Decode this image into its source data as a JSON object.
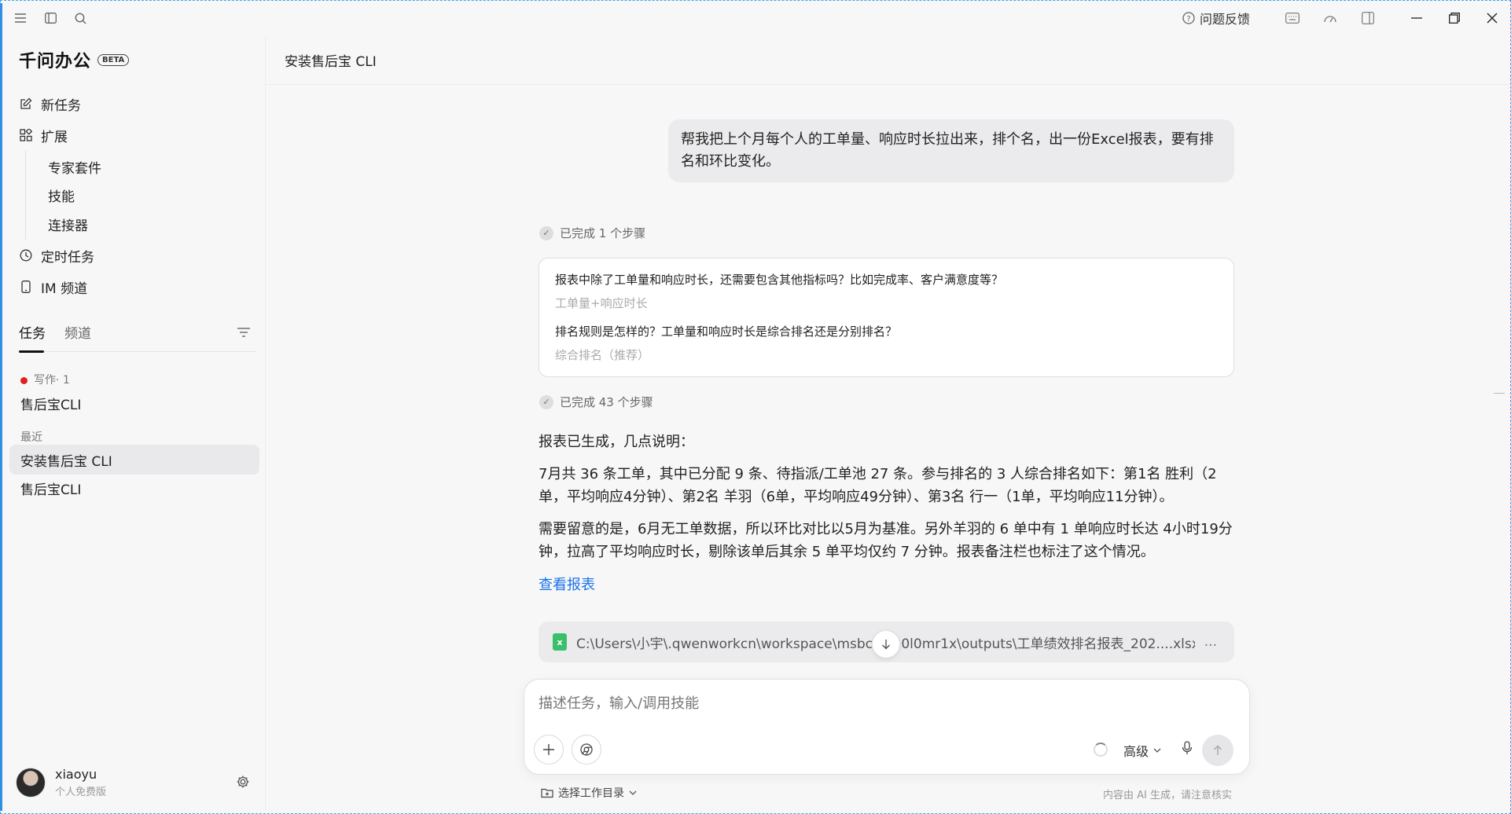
{
  "titlebar": {
    "feedback_label": "问题反馈"
  },
  "sidebar": {
    "brand": "千问办公",
    "beta": "BETA",
    "nav": {
      "new_task": "新任务",
      "extensions": "扩展",
      "expert_kits": "专家套件",
      "skills": "技能",
      "connectors": "连接器",
      "scheduled": "定时任务",
      "im_channel": "IM 频道"
    },
    "tabs": [
      "任务",
      "频道"
    ],
    "writing_group": "写作· 1",
    "writing_items": [
      "售后宝CLI"
    ],
    "recent_label": "最近",
    "recent_items": [
      "安装售后宝 CLI",
      "售后宝CLI"
    ],
    "user": {
      "name": "xiaoyu",
      "plan": "个人免费版"
    }
  },
  "main": {
    "title": "安装售后宝 CLI",
    "user_message": "帮我把上个月每个人的工单量、响应时长拉出来，排个名，出一份Excel报表，要有排名和环比变化。",
    "step1": "已完成 1 个步骤",
    "qa": [
      {
        "q": "报表中除了工单量和响应时长，还需要包含其他指标吗？比如完成率、客户满意度等？",
        "a": "工单量+响应时长"
      },
      {
        "q": "排名规则是怎样的？工单量和响应时长是综合排名还是分别排名？",
        "a": "综合排名（推荐）"
      }
    ],
    "step2": "已完成 43 个步骤",
    "reply_intro": "报表已生成，几点说明：",
    "reply_p1": "7月共 36 条工单，其中已分配 9 条、待指派/工单池 27 条。参与排名的 3 人综合排名如下：第1名 胜利（2单，平均响应4分钟）、第2名 羊羽（6单，平均响应49分钟）、第3名 行一（1单，平均响应11分钟）。",
    "reply_p2": "需要留意的是，6月无工单数据，所以环比对比以5月为基准。另外羊羽的 6 单中有 1 单响应时长达 4小时19分钟，拉高了平均响应时长，剔除该单后其余 5 单平均仅约 7 分钟。报表备注栏也标注了这个情况。",
    "view_report": "查看报表",
    "file_path": "C:\\Users\\小宇\\.qwenworkcn\\workspace\\msbc2c...0l0mr1x\\outputs\\工单绩效排名报表_202....xlsx",
    "file_more": "...",
    "composer": {
      "placeholder": "描述任务，输入/调用技能",
      "advanced": "高级"
    },
    "workdir": "选择工作目录",
    "disclaimer": "内容由 AI 生成，请注意核实"
  }
}
